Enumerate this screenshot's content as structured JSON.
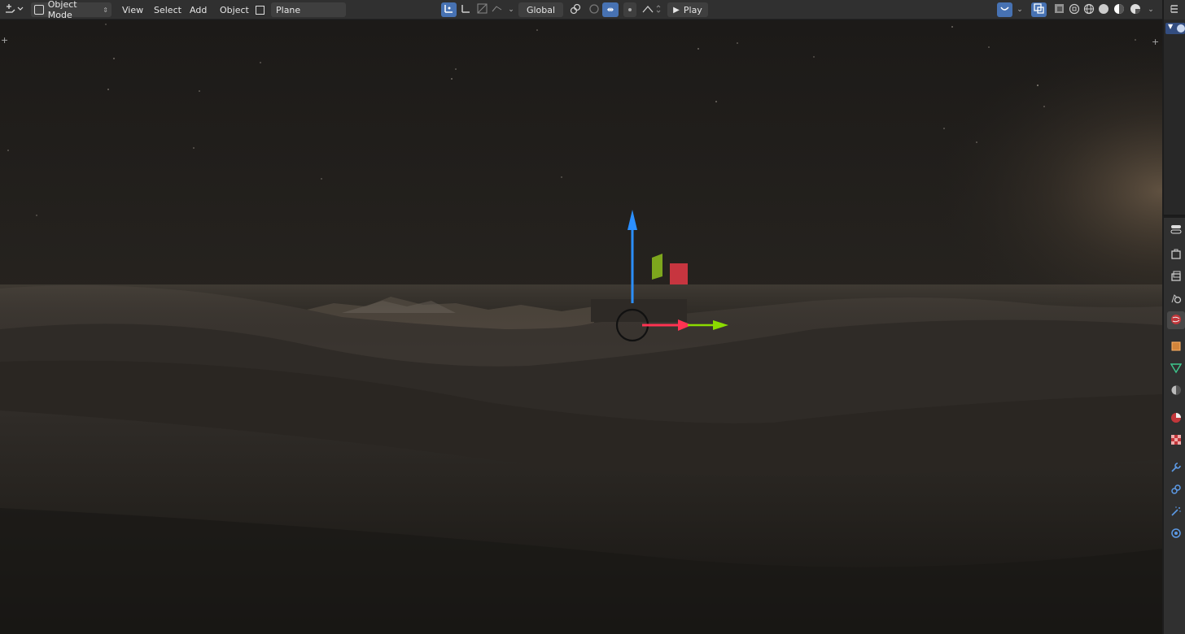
{
  "header": {
    "editor_type_icon": "editor-type-3d-viewport-icon",
    "mode_label": "Object Mode",
    "menus": [
      "View",
      "Select",
      "Add",
      "Object"
    ],
    "active_object_name": "Plane",
    "transform_orientation": "Global",
    "play_label": "Play"
  },
  "viewport": {
    "description_free": true
  },
  "outliner": {
    "editor_type_icon": "outliner-icon"
  },
  "properties": {
    "tabs": [
      "tool-icon",
      "render-icon",
      "output-icon",
      "view-layer-icon",
      "scene-icon",
      "world-icon",
      "object-icon",
      "modifier-mesh-data-icon",
      "particles-icon",
      "physics-icon",
      "material-icon",
      "texture-icon",
      "wrench-icon",
      "constraint-icon",
      "particle-wand-icon",
      "physics-circle-icon"
    ],
    "active_tab": "world-icon"
  },
  "colors": {
    "header_bg": "#303030",
    "active_blue": "#4772b3",
    "gizmo_z": "#2b8fff",
    "gizmo_x": "#ff3352",
    "gizmo_y": "#8bdc00"
  }
}
